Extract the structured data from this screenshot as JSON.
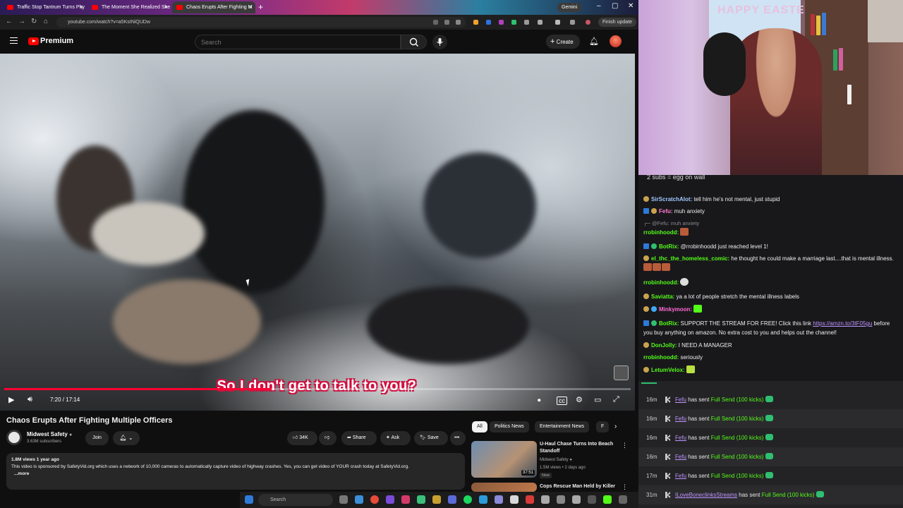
{
  "browser": {
    "tabs": [
      {
        "title": "Traffic Stop Tantrum Turns Phy"
      },
      {
        "title": "The Moment She Realized She"
      },
      {
        "title": "Chaos Erupts After Fighting M"
      }
    ],
    "gemini_label": "Gemini",
    "url": "youtube.com/watch?v=a5KsINiQUDw",
    "finish_update_label": "Finish update"
  },
  "youtube": {
    "logo_text": "Premium",
    "search_placeholder": "Search",
    "create_label": "Create"
  },
  "video": {
    "caption": "So I don't get to talk to you?",
    "time": "7:20 / 17:14",
    "progress_fraction": 0.4255,
    "title": "Chaos Erupts After Fighting Multiple Officers"
  },
  "channel": {
    "name": "Midwest Safety",
    "subscribers": "3.63M subscribers",
    "join_label": "Join"
  },
  "actions": {
    "likes": "34K",
    "share_label": "Share",
    "ask_label": "Ask",
    "save_label": "Save"
  },
  "description": {
    "meta": "1.8M views  1 year ago",
    "text": "This video is sponsored by SafetyVid.org which uses a network of 10,000 cameras to automatically capture video of highway crashes. Yes, you can get video of YOUR crash today at SafetyVid.org.",
    "more_label": "...more"
  },
  "related": {
    "chips": [
      {
        "label": "All"
      },
      {
        "label": "Politics News"
      },
      {
        "label": "Entertainment News"
      },
      {
        "label": "F"
      }
    ],
    "videos": [
      {
        "title": "U-Haul Chase Turns Into Beach Standoff",
        "channel": "Midwest Safety",
        "meta": "1.5M views • 2 days ago",
        "badge": "New",
        "duration": "37:51"
      },
      {
        "title": "Cops Rescue Man Held by Killer",
        "channel": "",
        "meta": "",
        "badge": "",
        "duration": ""
      }
    ]
  },
  "taskbar": {
    "search_label": "Search"
  },
  "stream": {
    "banner_text": "HAPPY EASTE"
  },
  "chat": {
    "top_line": "2 subs = egg on wall",
    "messages": [
      {
        "user": "SirScratchAlot:",
        "text": " tell him he's not mental, just stupid"
      },
      {
        "user": "Fefu:",
        "text": " muh anxiety"
      },
      {
        "reply": "@Fefu: muh anxiety"
      },
      {
        "user": "rrobinhoodd:",
        "text": ""
      },
      {
        "user": "BotRix:",
        "text": " @rrobinhoodd just reached level 1!"
      },
      {
        "user": "el_thc_the_homeless_comic:",
        "text": " he thought he could make a marriage last....that is mental illness."
      },
      {
        "user": "rrobinhoodd:",
        "text": ""
      },
      {
        "user": "Saviatta:",
        "text": " ya a lot of people stretch the mental illness labels"
      },
      {
        "user": "Minkymoon:",
        "text": ""
      },
      {
        "user": "BotRix:",
        "text": " SUPPORT THE STREAM FOR FREE! Click this link ",
        "link": "https://amzn.to/3tF05gu",
        "text2": " before you buy anything on amazon. No extra cost to you and helps out the channel!"
      },
      {
        "user": "DonJolly:",
        "text": " I NEED A MANAGER"
      },
      {
        "user": "rrobinhoodd:",
        "text": " seriously"
      },
      {
        "user": "LetumVelox:",
        "text": ""
      }
    ]
  },
  "events": [
    {
      "time": "16m",
      "user": "Fefu",
      "action": " has sent ",
      "gift": "Full Send (100 kicks)"
    },
    {
      "time": "16m",
      "user": "Fefu",
      "action": " has sent ",
      "gift": "Full Send (100 kicks)"
    },
    {
      "time": "16m",
      "user": "Fefu",
      "action": " has sent ",
      "gift": "Full Send (100 kicks)"
    },
    {
      "time": "16m",
      "user": "Fefu",
      "action": " has sent ",
      "gift": "Full Send (100 kicks)"
    },
    {
      "time": "17m",
      "user": "Fefu",
      "action": " has sent ",
      "gift": "Full Send (100 kicks)"
    },
    {
      "time": "31m",
      "user": "ILoveBoneclinksStreams",
      "action": " has sent ",
      "gift": "Full Send (100 kicks)"
    }
  ],
  "colors": {
    "youtube_red": "#ff0000",
    "progress_red": "#ff0033",
    "chat_username_blue": "#a0c8ff",
    "chat_username_green": "#53fc18",
    "kick_green": "#53fc18"
  }
}
